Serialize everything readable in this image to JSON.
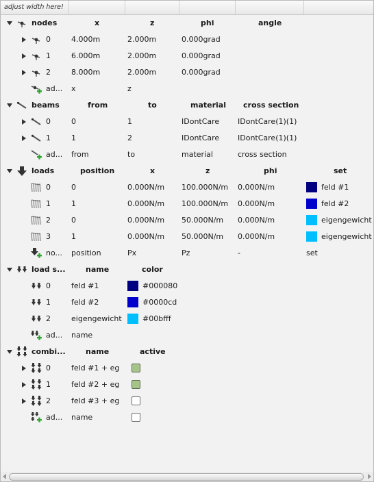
{
  "header": {
    "hint": "adjust width here!"
  },
  "rows": {
    "nodes": {
      "label": "nodes",
      "cols": [
        "x",
        "z",
        "phi",
        "angle"
      ],
      "items": [
        {
          "id": "0",
          "x": "4.000m",
          "z": "2.000m",
          "phi": "0.000grad"
        },
        {
          "id": "1",
          "x": "6.000m",
          "z": "2.000m",
          "phi": "0.000grad"
        },
        {
          "id": "2",
          "x": "8.000m",
          "z": "2.000m",
          "phi": "0.000grad"
        }
      ],
      "add": {
        "label": "ad...",
        "c1": "x",
        "c2": "z"
      }
    },
    "beams": {
      "label": "beams",
      "cols": [
        "from",
        "to",
        "material",
        "cross section"
      ],
      "items": [
        {
          "id": "0",
          "from": "0",
          "to": "1",
          "material": "IDontCare",
          "cs": "IDontCare(1)(1)"
        },
        {
          "id": "1",
          "from": "1",
          "to": "2",
          "material": "IDontCare",
          "cs": "IDontCare(1)(1)"
        }
      ],
      "add": {
        "label": "ad...",
        "c1": "from",
        "c2": "to",
        "c3": "material",
        "c4": "cross section"
      }
    },
    "loads": {
      "label": "loads",
      "cols": [
        "position",
        "x",
        "z",
        "phi",
        "set"
      ],
      "items": [
        {
          "id": "0",
          "position": "0",
          "x": "0.000N/m",
          "z": "100.000N/m",
          "phi": "0.000N/m",
          "set": "feld #1",
          "color": "#000080"
        },
        {
          "id": "1",
          "position": "1",
          "x": "0.000N/m",
          "z": "100.000N/m",
          "phi": "0.000N/m",
          "set": "feld #2",
          "color": "#0000cd"
        },
        {
          "id": "2",
          "position": "0",
          "x": "0.000N/m",
          "z": "50.000N/m",
          "phi": "0.000N/m",
          "set": "eigengewicht",
          "color": "#00bfff"
        },
        {
          "id": "3",
          "position": "1",
          "x": "0.000N/m",
          "z": "50.000N/m",
          "phi": "0.000N/m",
          "set": "eigengewicht",
          "color": "#00bfff"
        }
      ],
      "add": {
        "label": "no...",
        "c1": "position",
        "c2": "Px",
        "c3": "Pz",
        "c4": "-",
        "c5": "set"
      }
    },
    "loadsets": {
      "label": "load s...",
      "cols": [
        "name",
        "color"
      ],
      "items": [
        {
          "id": "0",
          "name": "feld #1",
          "color": "#000080"
        },
        {
          "id": "1",
          "name": "feld #2",
          "color": "#0000cd"
        },
        {
          "id": "2",
          "name": "eigengewicht",
          "color": "#00bfff"
        }
      ],
      "add": {
        "label": "ad...",
        "c1": "name"
      }
    },
    "combis": {
      "label": "combi...",
      "cols": [
        "name",
        "active"
      ],
      "items": [
        {
          "id": "0",
          "name": "feld #1 + eg",
          "active": true
        },
        {
          "id": "1",
          "name": "feld #2 + eg",
          "active": true
        },
        {
          "id": "2",
          "name": "feld #3 + eg",
          "active": false
        }
      ],
      "add": {
        "label": "ad...",
        "c1": "name",
        "active": false
      }
    }
  },
  "colors": {
    "swatch_feld1": "#000080",
    "swatch_feld2": "#0000cd",
    "swatch_eigengewicht": "#00bfff",
    "checkbox_on": "#a6c48a"
  }
}
